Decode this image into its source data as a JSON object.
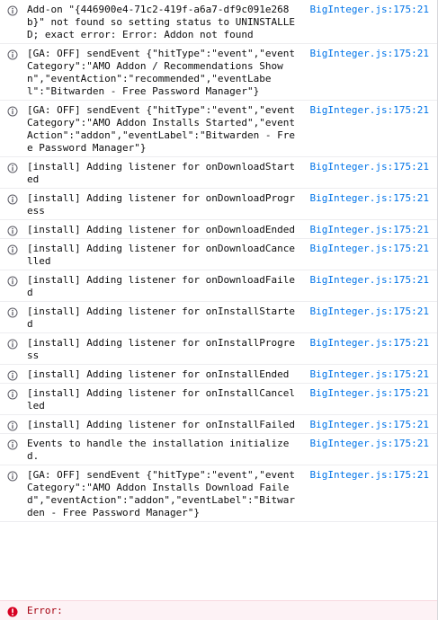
{
  "console": {
    "messages": [
      {
        "level": "info",
        "icon": "info-icon",
        "text": "Add-on \"{446900e4-71c2-419f-a6a7-df9c091e268b}\" not found so setting status to UNINSTALLED; exact error: Error: Addon not found",
        "source": "BigInteger.js:175:21"
      },
      {
        "level": "info",
        "icon": "info-icon",
        "text": "[GA: OFF] sendEvent {\"hitType\":\"event\",\"eventCategory\":\"AMO Addon / Recommendations Shown\",\"eventAction\":\"recommended\",\"eventLabel\":\"Bitwarden - Free Password Manager\"}",
        "source": "BigInteger.js:175:21"
      },
      {
        "level": "info",
        "icon": "info-icon",
        "text": "[GA: OFF] sendEvent {\"hitType\":\"event\",\"eventCategory\":\"AMO Addon Installs Started\",\"eventAction\":\"addon\",\"eventLabel\":\"Bitwarden - Free Password Manager\"}",
        "source": "BigInteger.js:175:21"
      },
      {
        "level": "info",
        "icon": "info-icon",
        "text": "[install] Adding listener for onDownloadStarted",
        "source": "BigInteger.js:175:21"
      },
      {
        "level": "info",
        "icon": "info-icon",
        "text": "[install] Adding listener for onDownloadProgress",
        "source": "BigInteger.js:175:21"
      },
      {
        "level": "info",
        "icon": "info-icon",
        "text": "[install] Adding listener for onDownloadEnded",
        "source": "BigInteger.js:175:21"
      },
      {
        "level": "info",
        "icon": "info-icon",
        "text": "[install] Adding listener for onDownloadCancelled",
        "source": "BigInteger.js:175:21"
      },
      {
        "level": "info",
        "icon": "info-icon",
        "text": "[install] Adding listener for onDownloadFailed",
        "source": "BigInteger.js:175:21"
      },
      {
        "level": "info",
        "icon": "info-icon",
        "text": "[install] Adding listener for onInstallStarted",
        "source": "BigInteger.js:175:21"
      },
      {
        "level": "info",
        "icon": "info-icon",
        "text": "[install] Adding listener for onInstallProgress",
        "source": "BigInteger.js:175:21"
      },
      {
        "level": "info",
        "icon": "info-icon",
        "text": "[install] Adding listener for onInstallEnded",
        "source": "BigInteger.js:175:21"
      },
      {
        "level": "info",
        "icon": "info-icon",
        "text": "[install] Adding listener for onInstallCancelled",
        "source": "BigInteger.js:175:21"
      },
      {
        "level": "info",
        "icon": "info-icon",
        "text": "[install] Adding listener for onInstallFailed",
        "source": "BigInteger.js:175:21"
      },
      {
        "level": "info",
        "icon": "info-icon",
        "text": "Events to handle the installation initialized.",
        "source": "BigInteger.js:175:21"
      },
      {
        "level": "info",
        "icon": "info-icon",
        "text": "[GA: OFF] sendEvent {\"hitType\":\"event\",\"eventCategory\":\"AMO Addon Installs Download Failed\",\"eventAction\":\"addon\",\"eventLabel\":\"Bitwarden - Free Password Manager\"}",
        "source": "BigInteger.js:175:21"
      }
    ],
    "error": {
      "level": "error",
      "icon": "error-icon",
      "text": "Error:"
    }
  },
  "colors": {
    "info_icon": "#5c5c66",
    "source_link": "#0074e8",
    "error_icon": "#d70022",
    "error_text": "#a4000f",
    "error_bg": "#fdf2f5"
  }
}
